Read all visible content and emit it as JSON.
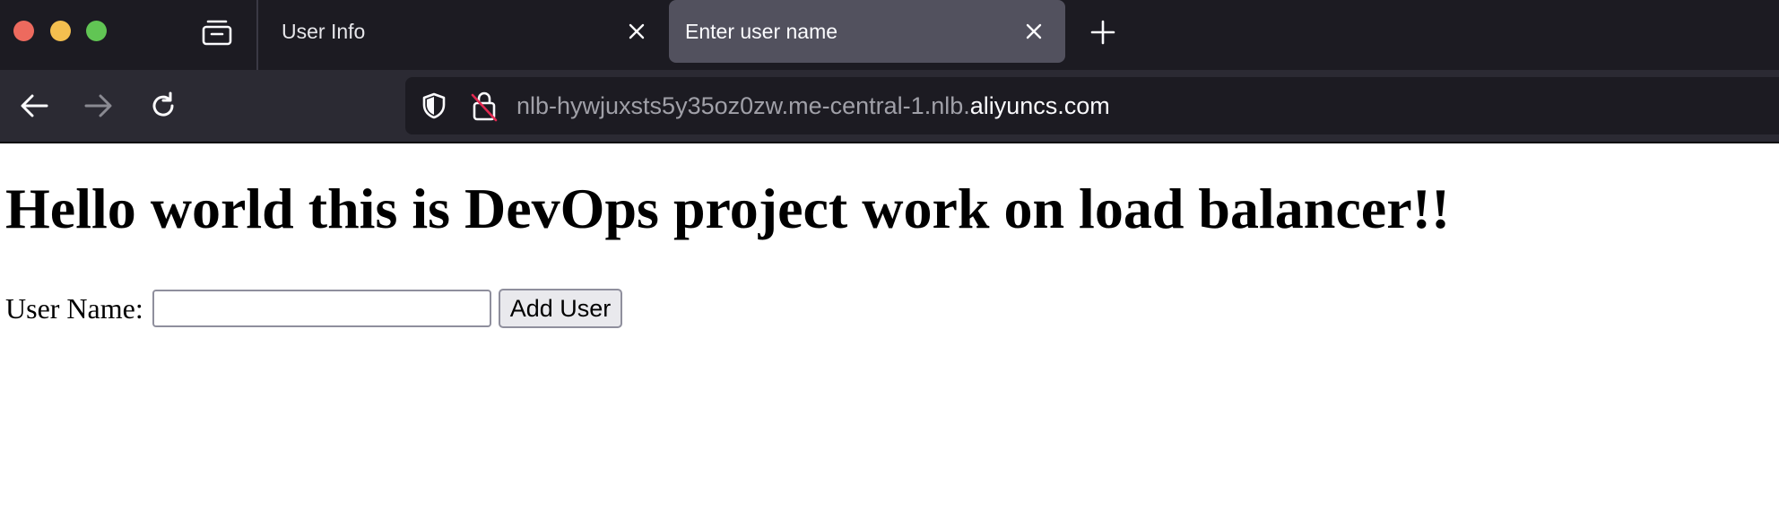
{
  "window": {
    "controls": [
      "close",
      "minimize",
      "zoom"
    ]
  },
  "tabs": [
    {
      "title": "User Info",
      "active": false
    },
    {
      "title": "Enter user name",
      "active": true
    }
  ],
  "nav": {
    "back_icon": "arrow-left-icon",
    "forward_icon": "arrow-right-icon",
    "reload_icon": "reload-icon"
  },
  "urlbar": {
    "prefix": "nlb-hywjuxsts5y35oz0zw.me-central-1.nlb.",
    "domain": "aliyuncs.com"
  },
  "page": {
    "heading": "Hello world this is DevOps project work on load balancer!!",
    "form": {
      "label": "User Name:",
      "input_value": "",
      "button_label": "Add User"
    }
  },
  "colors": {
    "tabbar_bg": "#1c1b22",
    "navbar_bg": "#2b2a33",
    "active_tab_bg": "#52515e",
    "close_dot": "#ed6a5e",
    "minimize_dot": "#f4bf4f",
    "zoom_dot": "#61c554"
  }
}
